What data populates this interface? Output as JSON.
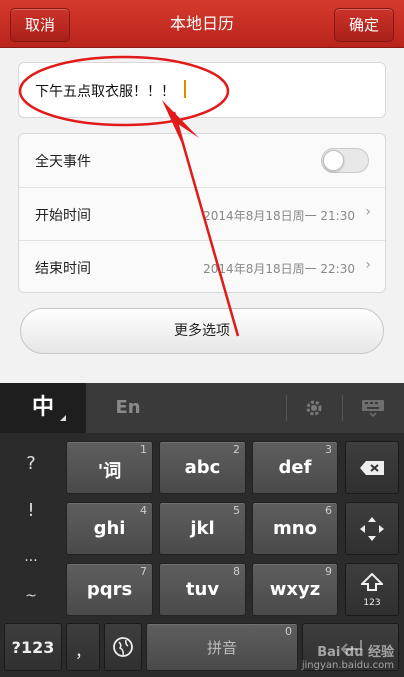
{
  "titlebar": {
    "cancel_label": "取消",
    "title": "本地日历",
    "confirm_label": "确定"
  },
  "event": {
    "title_value": "下午五点取衣服！！！"
  },
  "settings": {
    "allday_label": "全天事件",
    "start_label": "开始时间",
    "start_value": "2014年8月18日周一 21:30",
    "end_label": "结束时间",
    "end_value": "2014年8月18日周一 22:30",
    "chevron": "›"
  },
  "more_options_label": "更多选项",
  "keyboard": {
    "tab_zh": "中",
    "tab_en": "En",
    "side_keys": [
      "?",
      "!",
      "...",
      "~"
    ],
    "keys": [
      {
        "label": "'词",
        "num": "1"
      },
      {
        "label": "abc",
        "num": "2"
      },
      {
        "label": "def",
        "num": "3"
      },
      {
        "label": "ghi",
        "num": "4"
      },
      {
        "label": "jkl",
        "num": "5"
      },
      {
        "label": "mno",
        "num": "6"
      },
      {
        "label": "pqrs",
        "num": "7"
      },
      {
        "label": "tuv",
        "num": "8"
      },
      {
        "label": "wxyz",
        "num": "9"
      }
    ],
    "key_123": "?123",
    "key_comma": "，",
    "key_space": "拼音",
    "key_zero": "0",
    "shift_sub": "123"
  },
  "watermark": {
    "line1": "Bai du 经验",
    "line2": "jingyan.baidu.com"
  },
  "annotation_color": "#e11a1a",
  "accent_color": "#c52a20"
}
